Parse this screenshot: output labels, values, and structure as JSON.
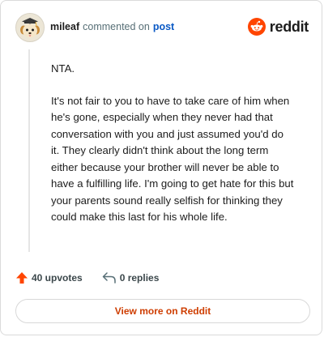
{
  "header": {
    "username": "mileaf",
    "action_text": "commented on",
    "post_link": "post",
    "brand": "reddit"
  },
  "comment": {
    "paragraphs": [
      "NTA.",
      "It's not fair to you to have to take care of him when he's gone, especially when they never had that conversation with you and just assumed you'd do it. They clearly didn't think about the long term either because your brother will never be able to have a fulfilling life. I'm going to get hate for this but your parents sound really selfish for thinking they could make this last for his whole life."
    ]
  },
  "actions": {
    "upvotes": "40 upvotes",
    "replies": "0 replies"
  },
  "footer": {
    "view_more": "View more on Reddit"
  },
  "colors": {
    "brand_orange": "#ff4500",
    "link_blue": "#0a59c5",
    "view_more_text": "#ce3d00"
  },
  "icons": {
    "avatar": "snoo-avatar-with-graduation-cap",
    "brand": "reddit-snoo-icon",
    "upvote": "upvote-arrow-icon",
    "reply": "reply-arrow-icon"
  }
}
